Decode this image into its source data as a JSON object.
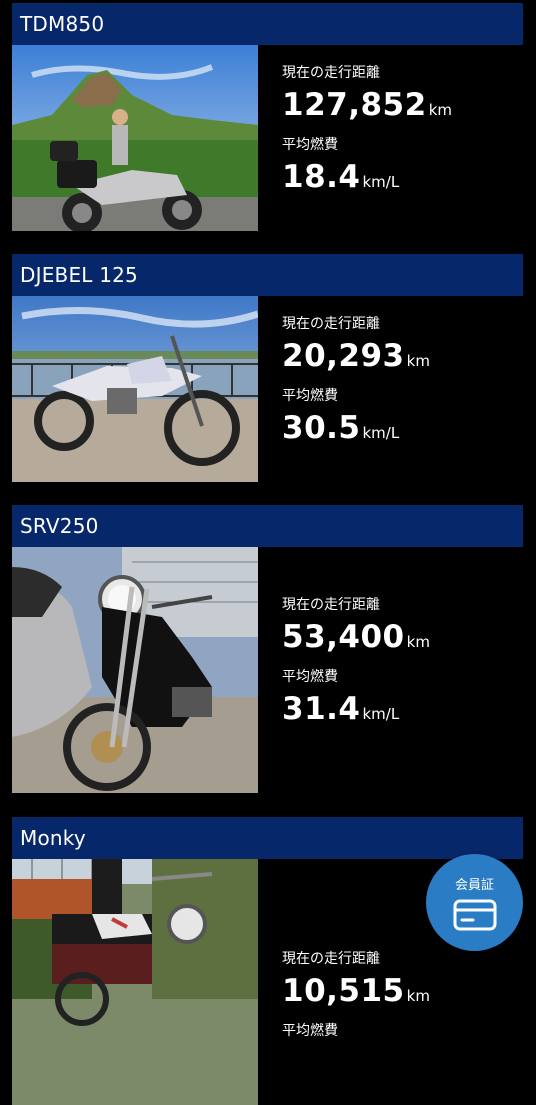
{
  "colors": {
    "background": "#000000",
    "header_bar": "#07276b",
    "fab": "#2a7cc4",
    "text": "#ffffff"
  },
  "bikes": [
    {
      "name": "TDM850",
      "odometer_label": "現在の走行距離",
      "odometer_value": "127,852",
      "odometer_unit": "km",
      "fuel_label": "平均燃費",
      "fuel_value": "18.4",
      "fuel_unit": "km/L",
      "photo_icon": "motorcycle-photo"
    },
    {
      "name": "DJEBEL 125",
      "odometer_label": "現在の走行距離",
      "odometer_value": "20,293",
      "odometer_unit": "km",
      "fuel_label": "平均燃費",
      "fuel_value": "30.5",
      "fuel_unit": "km/L",
      "photo_icon": "motorcycle-photo"
    },
    {
      "name": "SRV250",
      "odometer_label": "現在の走行距離",
      "odometer_value": "53,400",
      "odometer_unit": "km",
      "fuel_label": "平均燃費",
      "fuel_value": "31.4",
      "fuel_unit": "km/L",
      "photo_icon": "motorcycle-photo"
    },
    {
      "name": "Monky",
      "odometer_label": "現在の走行距離",
      "odometer_value": "10,515",
      "odometer_unit": "km",
      "fuel_label": "平均燃費",
      "fuel_value": "",
      "fuel_unit": "",
      "photo_icon": "motorcycle-photo"
    }
  ],
  "member_card_button": {
    "label": "会員証",
    "icon": "card-icon"
  }
}
